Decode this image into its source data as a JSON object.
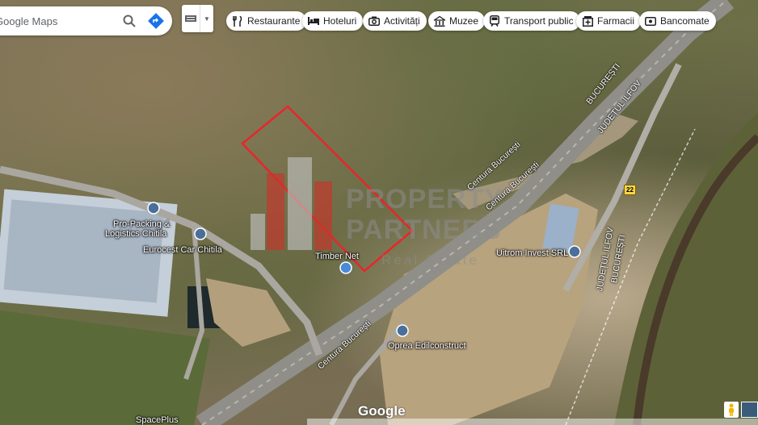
{
  "search": {
    "placeholder": "Google Maps"
  },
  "chips": [
    {
      "label": "Restaurante",
      "icon": "fork-knife-icon"
    },
    {
      "label": "Hoteluri",
      "icon": "bed-icon"
    },
    {
      "label": "Activități",
      "icon": "camera-icon"
    },
    {
      "label": "Muzee",
      "icon": "museum-icon"
    },
    {
      "label": "Transport public",
      "icon": "train-icon"
    },
    {
      "label": "Farmacii",
      "icon": "pharmacy-icon"
    },
    {
      "label": "Bancomate",
      "icon": "atm-icon"
    }
  ],
  "places": {
    "propacking_line1": "Pro-Packing &",
    "propacking_line2": "Logistics Chitila",
    "eurocest": "Eurocest Car Chitila",
    "timber": "Timber Net",
    "uitrom": "Uitrom Invest SRL",
    "oprea": "Oprea Edilconstruct",
    "spaceplus": "SpacePlus"
  },
  "roads": {
    "bucuresti": "BUCUREȘTI",
    "judetul_ilfov": "JUDEȚUL ILFOV",
    "centura1": "Centura București",
    "centura2": "Centura București",
    "centura3": "Centura București",
    "judetul_ilfov2": "JUDEȚUL ILFOV",
    "bucuresti2": "BUCUREȘTI",
    "route_number": "22"
  },
  "watermark": {
    "line1": "PROPERTY",
    "line2": "PARTNERS",
    "line3": "Real Estate"
  },
  "google_logo": "Google",
  "colors": {
    "highlight": "#e8262b",
    "pin": "#4a6f9a",
    "logo_red": "#c8352a"
  }
}
